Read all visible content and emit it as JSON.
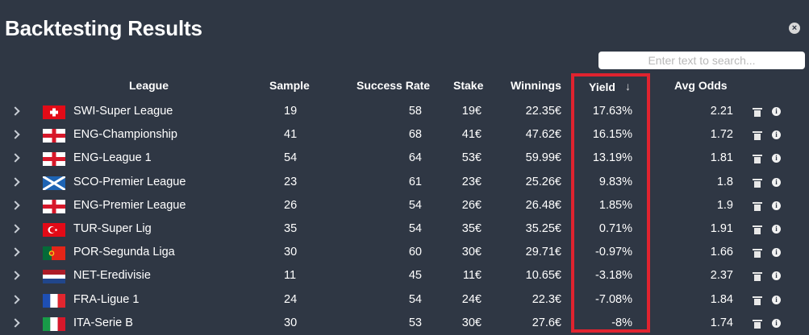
{
  "window": {
    "title": "Backtesting Results",
    "close_glyph": "×"
  },
  "search": {
    "placeholder": "Enter text to search..."
  },
  "columns": {
    "league": "League",
    "sample": "Sample",
    "success_rate": "Success Rate",
    "stake": "Stake",
    "winnings": "Winnings",
    "yield": "Yield",
    "yield_sort": "↓",
    "avg_odds": "Avg Odds"
  },
  "rows": [
    {
      "league": "SWI-Super League",
      "flag": "switzerland-flag",
      "sample": "19",
      "success_rate": "58",
      "stake": "19€",
      "winnings": "22.35€",
      "yield": "17.63%",
      "avg_odds": "2.21"
    },
    {
      "league": "ENG-Championship",
      "flag": "england-flag",
      "sample": "41",
      "success_rate": "68",
      "stake": "41€",
      "winnings": "47.62€",
      "yield": "16.15%",
      "avg_odds": "1.72"
    },
    {
      "league": "ENG-League 1",
      "flag": "england-flag",
      "sample": "54",
      "success_rate": "64",
      "stake": "53€",
      "winnings": "59.99€",
      "yield": "13.19%",
      "avg_odds": "1.81"
    },
    {
      "league": "SCO-Premier League",
      "flag": "scotland-flag",
      "sample": "23",
      "success_rate": "61",
      "stake": "23€",
      "winnings": "25.26€",
      "yield": "9.83%",
      "avg_odds": "1.8"
    },
    {
      "league": "ENG-Premier League",
      "flag": "england-flag",
      "sample": "26",
      "success_rate": "54",
      "stake": "26€",
      "winnings": "26.48€",
      "yield": "1.85%",
      "avg_odds": "1.9"
    },
    {
      "league": "TUR-Super Lig",
      "flag": "turkey-flag",
      "sample": "35",
      "success_rate": "54",
      "stake": "35€",
      "winnings": "35.25€",
      "yield": "0.71%",
      "avg_odds": "1.91"
    },
    {
      "league": "POR-Segunda Liga",
      "flag": "portugal-flag",
      "sample": "30",
      "success_rate": "60",
      "stake": "30€",
      "winnings": "29.71€",
      "yield": "-0.97%",
      "avg_odds": "1.66"
    },
    {
      "league": "NET-Eredivisie",
      "flag": "netherlands-flag",
      "sample": "11",
      "success_rate": "45",
      "stake": "11€",
      "winnings": "10.65€",
      "yield": "-3.18%",
      "avg_odds": "2.37"
    },
    {
      "league": "FRA-Ligue 1",
      "flag": "france-flag",
      "sample": "24",
      "success_rate": "54",
      "stake": "24€",
      "winnings": "22.3€",
      "yield": "-7.08%",
      "avg_odds": "1.84"
    },
    {
      "league": "ITA-Serie B",
      "flag": "italy-flag",
      "sample": "30",
      "success_rate": "53",
      "stake": "30€",
      "winnings": "27.6€",
      "yield": "-8%",
      "avg_odds": "1.74"
    }
  ],
  "colors": {
    "background": "#2f3744",
    "highlight": "#e0232f",
    "text": "#ffffff"
  }
}
